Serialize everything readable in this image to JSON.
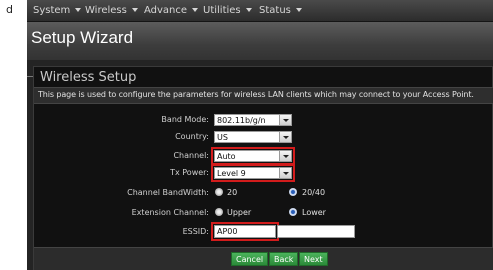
{
  "side_mark": "d",
  "menu": [
    {
      "label": "System"
    },
    {
      "label": "Wireless"
    },
    {
      "label": "Advance"
    },
    {
      "label": "Utilities"
    },
    {
      "label": "Status"
    }
  ],
  "page_title": "Setup Wizard",
  "section": {
    "title": "Wireless Setup",
    "description": "This page is used to configure the parameters for wireless LAN clients which may connect to your Access Point."
  },
  "form": {
    "band_mode": {
      "label": "Band Mode:",
      "value": "802.11b/g/n"
    },
    "country": {
      "label": "Country:",
      "value": "US"
    },
    "channel": {
      "label": "Channel:",
      "value": "Auto",
      "highlighted": true
    },
    "tx_power": {
      "label": "Tx Power:",
      "value": "Level 9",
      "highlighted": true
    },
    "bandwidth": {
      "label": "Channel BandWidth:",
      "options": [
        "20",
        "20/40"
      ],
      "selected": "20/40"
    },
    "extension": {
      "label": "Extension Channel:",
      "options": [
        "Upper",
        "Lower"
      ],
      "selected": "Lower"
    },
    "essid": {
      "label": "ESSID:",
      "value": "AP00",
      "highlighted": true
    }
  },
  "buttons": {
    "cancel": "Cancel",
    "back": "Back",
    "next": "Next"
  },
  "colors": {
    "highlight": "#d21c1c",
    "button_green": "#2b8a39",
    "background": "#242424"
  }
}
